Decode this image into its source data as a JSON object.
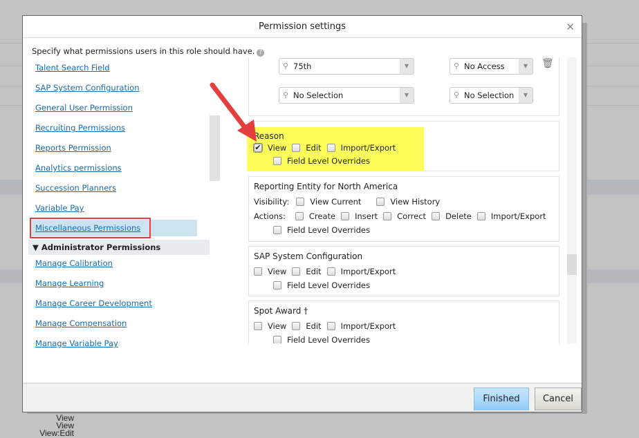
{
  "dialog": {
    "title": "Permission settings",
    "intro": "Specify what permissions users in this role should have.",
    "finished": "Finished",
    "cancel": "Cancel"
  },
  "left": {
    "items": [
      "Talent Search Field",
      "SAP System Configuration",
      "General User Permission",
      "Recruiting Permissions",
      "Reports Permission",
      "Analytics permissions",
      "Succession Planners",
      "Variable Pay",
      "Miscellaneous Permissions"
    ],
    "section": "Administrator Permissions",
    "admin_items": [
      "Manage Calibration",
      "Manage Learning",
      "Manage Career Development",
      "Manage Compensation",
      "Manage Variable Pay"
    ]
  },
  "right": {
    "selects": [
      "75th",
      "No Access",
      "No Selection",
      "No Selection"
    ],
    "reason": {
      "title": "Reason",
      "view": "View",
      "edit": "Edit",
      "import": "Import/Export",
      "flo": "Field Level Overrides",
      "view_checked": true
    },
    "entity": {
      "title": "Reporting Entity for North America",
      "visibility": "Visibility:",
      "view_current": "View Current",
      "view_history": "View History",
      "actions": "Actions:",
      "create": "Create",
      "insert": "Insert",
      "correct": "Correct",
      "delete": "Delete",
      "import": "Import/Export",
      "flo": "Field Level Overrides"
    },
    "sap": {
      "title": "SAP System Configuration",
      "view": "View",
      "edit": "Edit",
      "import": "Import/Export",
      "flo": "Field Level Overrides"
    },
    "spot": {
      "title": "Spot Award †",
      "view": "View",
      "edit": "Edit",
      "import": "Import/Export",
      "flo": "Field Level Overrides"
    }
  },
  "background": {
    "lines": [
      "View",
      "View",
      "View:Edit"
    ]
  },
  "colors": {
    "highlight": "#fefe5a",
    "annotation": "#e43f3f",
    "link": "#1a6aa8"
  }
}
